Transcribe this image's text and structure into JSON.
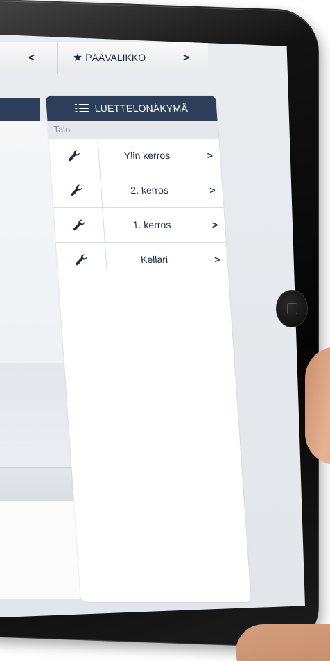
{
  "topbar": {
    "prev_label": "<",
    "home_label": "PÄÄVALIKKO",
    "next_label": ">"
  },
  "list_panel": {
    "header_label": "LUETTELONÄKYMÄ",
    "section_label": "Talo",
    "items": [
      {
        "label": "Ylin kerros",
        "icon": "wrench-icon",
        "chevron": ">"
      },
      {
        "label": "2. kerros",
        "icon": "wrench-icon",
        "chevron": ">"
      },
      {
        "label": "1. kerros",
        "icon": "wrench-icon",
        "chevron": ">"
      },
      {
        "label": "Kellari",
        "icon": "wrench-icon",
        "chevron": ">"
      }
    ]
  },
  "colors": {
    "header_bg": "#2c3e5a",
    "text_dark": "#1f2d44",
    "section_bg": "#e4e7eb"
  }
}
